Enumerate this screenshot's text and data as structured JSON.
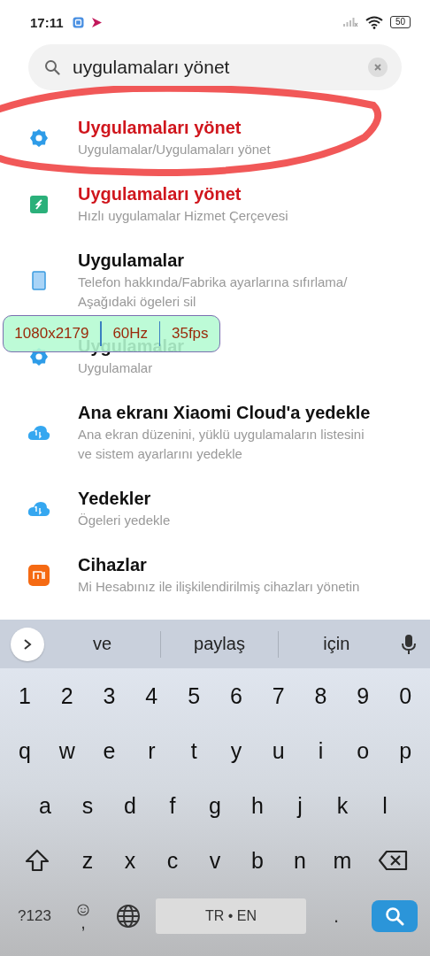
{
  "status_bar": {
    "time": "17:11",
    "battery": "50"
  },
  "search": {
    "value": "uygulamaları yönet"
  },
  "results": [
    {
      "kind": "gear",
      "title": "Uygulamaları yönet",
      "subtitle": "Uygulamalar/Uygulamaları yönet",
      "highlighted": true
    },
    {
      "kind": "bolt",
      "title": "Uygulamaları yönet",
      "subtitle": "Hızlı uygulamalar Hizmet Çerçevesi",
      "highlighted": true
    },
    {
      "kind": "phone",
      "title": "Uygulamalar",
      "subtitle": "Telefon hakkında/Fabrika ayarlarına sıfırlama/ Aşağıdaki ögeleri sil",
      "highlighted": false
    },
    {
      "kind": "gear",
      "title": "Uygulamalar",
      "subtitle": "Uygulamalar",
      "highlighted": false
    },
    {
      "kind": "cloud",
      "title": "Ana ekranı Xiaomi Cloud'a yedekle",
      "subtitle": "Ana ekran düzenini, yüklü uygulamaların listesini ve sistem ayarlarını yedekle",
      "highlighted": false
    },
    {
      "kind": "cloud",
      "title": "Yedekler",
      "subtitle": "Ögeleri yedekle",
      "highlighted": false
    },
    {
      "kind": "mi",
      "title": "Cihazlar",
      "subtitle": "Mi Hesabınız ile ilişkilendirilmiş cihazları yönetin",
      "highlighted": false
    }
  ],
  "fps_overlay": [
    "1080x2179",
    "60Hz",
    "35fps"
  ],
  "keyboard": {
    "suggestions": [
      "ve",
      "paylaş",
      "için"
    ],
    "rows": [
      [
        "1",
        "2",
        "3",
        "4",
        "5",
        "6",
        "7",
        "8",
        "9",
        "0"
      ],
      [
        "q",
        "w",
        "e",
        "r",
        "t",
        "y",
        "u",
        "i",
        "o",
        "p"
      ],
      [
        "a",
        "s",
        "d",
        "f",
        "g",
        "h",
        "j",
        "k",
        "l"
      ],
      [
        "z",
        "x",
        "c",
        "v",
        "b",
        "n",
        "m"
      ]
    ],
    "symbols_key": "?123",
    "comma_key": ",",
    "space_key": "TR • EN",
    "period_key": "."
  }
}
